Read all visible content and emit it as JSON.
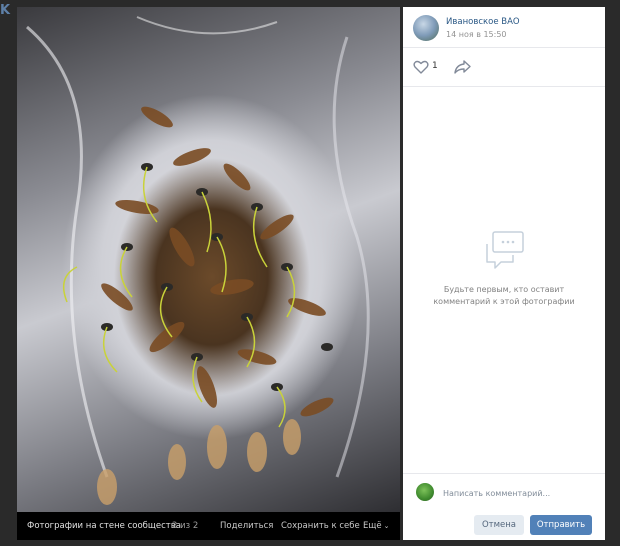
{
  "colors": {
    "accent": "#5181b8",
    "link": "#2a5885",
    "backdrop": "#222222",
    "muted_text": "#828282"
  },
  "viewer": {
    "photo": {
      "description_icon": "photo-seeds-sprouting"
    },
    "bar": {
      "album": "Фотографии на стене сообщества",
      "counter": "2 из 2",
      "share": "Поделиться",
      "save": "Сохранить к себе",
      "more": "Ещё"
    }
  },
  "post": {
    "group_name": "Ивановское ВАО",
    "time": "14 ноя в 15:50",
    "likes": "1",
    "like_icon": "heart-icon",
    "share_icon": "share-arrow-icon"
  },
  "comments": {
    "empty_line1": "Будьте первым, кто оставит",
    "empty_line2": "комментарий к этой фотографии",
    "empty_icon": "comments-bubble-icon",
    "input_placeholder": "Написать комментарий...",
    "cancel": "Отмена",
    "send": "Отправить"
  }
}
